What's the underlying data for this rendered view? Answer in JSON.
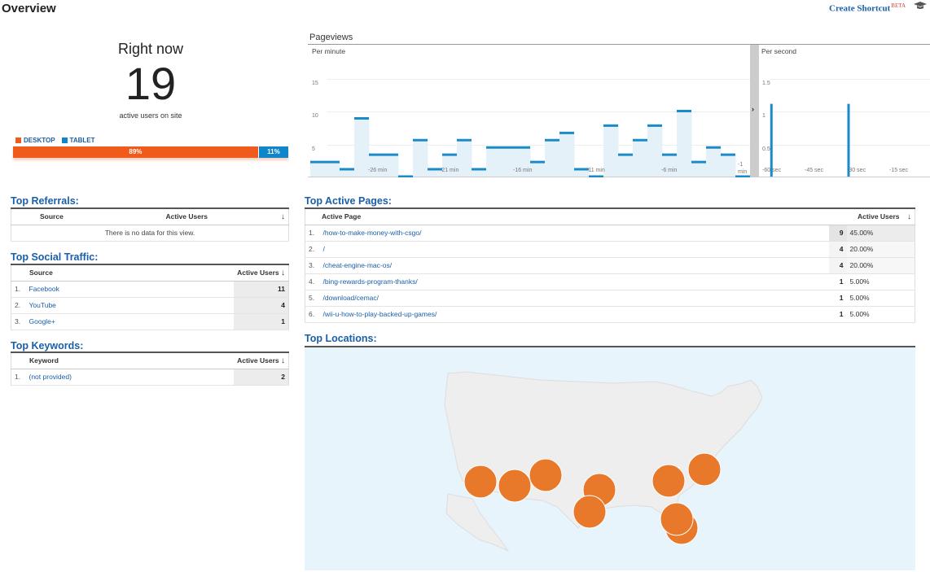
{
  "header": {
    "title": "Overview",
    "shortcut_label": "Create Shortcut",
    "shortcut_badge": "BETA"
  },
  "right_now": {
    "label": "Right now",
    "count": "19",
    "subtitle": "active users on site",
    "legend": [
      {
        "label": "DESKTOP",
        "color": "#f05a1a"
      },
      {
        "label": "TABLET",
        "color": "#0f86c9"
      }
    ],
    "devices": [
      {
        "name": "DESKTOP",
        "percent_label": "89%",
        "percent": 89,
        "color": "#f05a1a"
      },
      {
        "name": "TABLET",
        "percent_label": "11%",
        "percent": 11,
        "color": "#0f86c9"
      }
    ]
  },
  "top_referrals": {
    "title": "Top Referrals:",
    "columns": [
      "Source",
      "Active Users"
    ],
    "empty_message": "There is no data for this view."
  },
  "top_social": {
    "title": "Top Social Traffic:",
    "columns": [
      "Source",
      "Active Users"
    ],
    "rows": [
      {
        "idx": "1.",
        "source": "Facebook",
        "users": "11"
      },
      {
        "idx": "2.",
        "source": "YouTube",
        "users": "4"
      },
      {
        "idx": "3.",
        "source": "Google+",
        "users": "1"
      }
    ]
  },
  "top_keywords": {
    "title": "Top Keywords:",
    "columns": [
      "Keyword",
      "Active Users"
    ],
    "rows": [
      {
        "idx": "1.",
        "keyword": "(not provided)",
        "users": "2"
      }
    ]
  },
  "top_pages": {
    "title": "Top Active Pages:",
    "columns": [
      "Active Page",
      "Active Users"
    ],
    "rows": [
      {
        "idx": "1.",
        "page": "/how-to-make-money-with-csgo/",
        "users": "9",
        "pct": "45.00%"
      },
      {
        "idx": "2.",
        "page": "/",
        "users": "4",
        "pct": "20.00%"
      },
      {
        "idx": "3.",
        "page": "/cheat-engine-mac-os/",
        "users": "4",
        "pct": "20.00%"
      },
      {
        "idx": "4.",
        "page": "/bing-rewards-program-thanks/",
        "users": "1",
        "pct": "5.00%"
      },
      {
        "idx": "5.",
        "page": "/download/cemac/",
        "users": "1",
        "pct": "5.00%"
      },
      {
        "idx": "6.",
        "page": "/wii-u-how-to-play-backed-up-games/",
        "users": "1",
        "pct": "5.00%"
      }
    ]
  },
  "pageviews": {
    "title": "Pageviews",
    "per_minute": {
      "label": "Per minute",
      "yticks": [
        "15",
        "10",
        "5"
      ],
      "xticks": [
        "-26 min",
        "-21 min",
        "-16 min",
        "-11 min",
        "-6 min",
        "-1 min"
      ]
    },
    "per_second": {
      "label": "Per second",
      "yticks": [
        "1.5",
        "1",
        "0.5"
      ],
      "xticks": [
        "-60 sec",
        "-45 sec",
        "-30 sec",
        "-15 sec"
      ]
    }
  },
  "top_locations": {
    "title": "Top Locations:"
  },
  "chart_data": [
    {
      "type": "area",
      "title": "Per minute",
      "xlabel": "min",
      "ylim": [
        0,
        17
      ],
      "x": [
        -30,
        -29,
        -28,
        -27,
        -26,
        -25,
        -24,
        -23,
        -22,
        -21,
        -20,
        -19,
        -18,
        -17,
        -16,
        -15,
        -14,
        -13,
        -12,
        -11,
        -10,
        -9,
        -8,
        -7,
        -6,
        -5,
        -4,
        -3,
        -2,
        -1
      ],
      "values": [
        2,
        2,
        1,
        8,
        3,
        3,
        0,
        5,
        1,
        3,
        5,
        1,
        4,
        4,
        4,
        2,
        5,
        6,
        1,
        0,
        7,
        3,
        5,
        7,
        3,
        9,
        2,
        4,
        3,
        0
      ]
    },
    {
      "type": "bar",
      "title": "Per second",
      "ylim": [
        0,
        1.7
      ],
      "x": [
        -59,
        -30
      ],
      "values": [
        1,
        1
      ]
    }
  ],
  "map": {
    "region": "United States",
    "marker_color": "#e8782a",
    "water_color": "#e8f4fb",
    "land_color": "#eeeeee"
  }
}
